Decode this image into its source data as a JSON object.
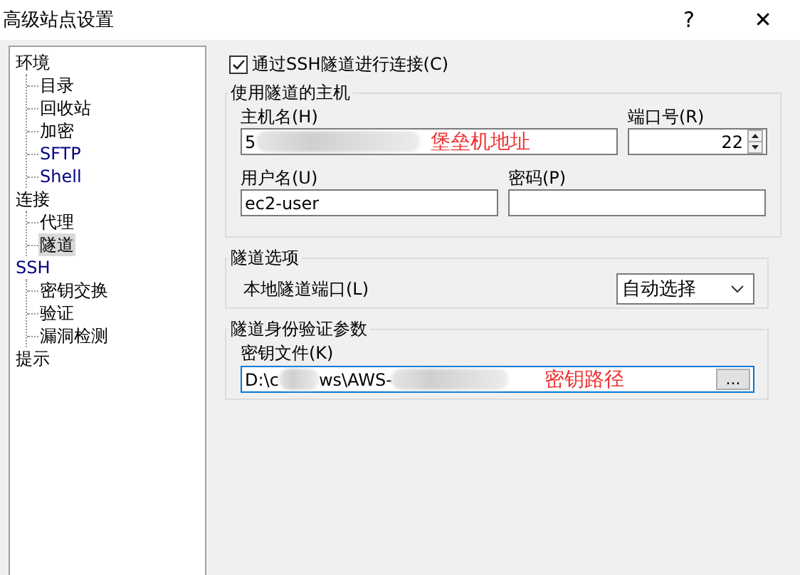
{
  "window": {
    "title": "高级站点设置",
    "help": "?",
    "close": "✕"
  },
  "tree": [
    {
      "label": "环境",
      "selected": false,
      "color": "#000000",
      "children": [
        {
          "label": "目录",
          "selected": false,
          "color": "#000000"
        },
        {
          "label": "回收站",
          "selected": false,
          "color": "#000000"
        },
        {
          "label": "加密",
          "selected": false,
          "color": "#000000"
        },
        {
          "label": "SFTP",
          "selected": false,
          "color": "#000080"
        },
        {
          "label": "Shell",
          "selected": false,
          "color": "#000080"
        }
      ]
    },
    {
      "label": "连接",
      "selected": false,
      "color": "#000000",
      "children": [
        {
          "label": "代理",
          "selected": false,
          "color": "#000000"
        },
        {
          "label": "隧道",
          "selected": true,
          "color": "#000000"
        }
      ]
    },
    {
      "label": "SSH",
      "selected": false,
      "color": "#000080",
      "children": [
        {
          "label": "密钥交换",
          "selected": false,
          "color": "#000000"
        },
        {
          "label": "验证",
          "selected": false,
          "color": "#000000"
        },
        {
          "label": "漏洞检测",
          "selected": false,
          "color": "#000000"
        }
      ]
    },
    {
      "label": "提示",
      "selected": false,
      "color": "#000000"
    }
  ],
  "tunnel_checkbox": {
    "label": "通过SSH隧道进行连接(C)",
    "checked": true
  },
  "host_group": {
    "title": "使用隧道的主机",
    "host": {
      "label": "主机名(H)",
      "value": "5",
      "annotation": "堡垒机地址"
    },
    "port": {
      "label": "端口号(R)",
      "value": "22"
    },
    "username": {
      "label": "用户名(U)",
      "value": "ec2-user"
    },
    "password": {
      "label": "密码(P)"
    }
  },
  "options_group": {
    "title": "隧道选项",
    "local_port": {
      "label": "本地隧道端口(L)",
      "value": "自动选择"
    }
  },
  "auth_group": {
    "title": "隧道身份验证参数",
    "key_file": {
      "label": "密钥文件(K)",
      "value_parts": [
        "D:\\c",
        "ws\\AWS-"
      ],
      "annotation": "密钥路径",
      "browse": "..."
    }
  }
}
